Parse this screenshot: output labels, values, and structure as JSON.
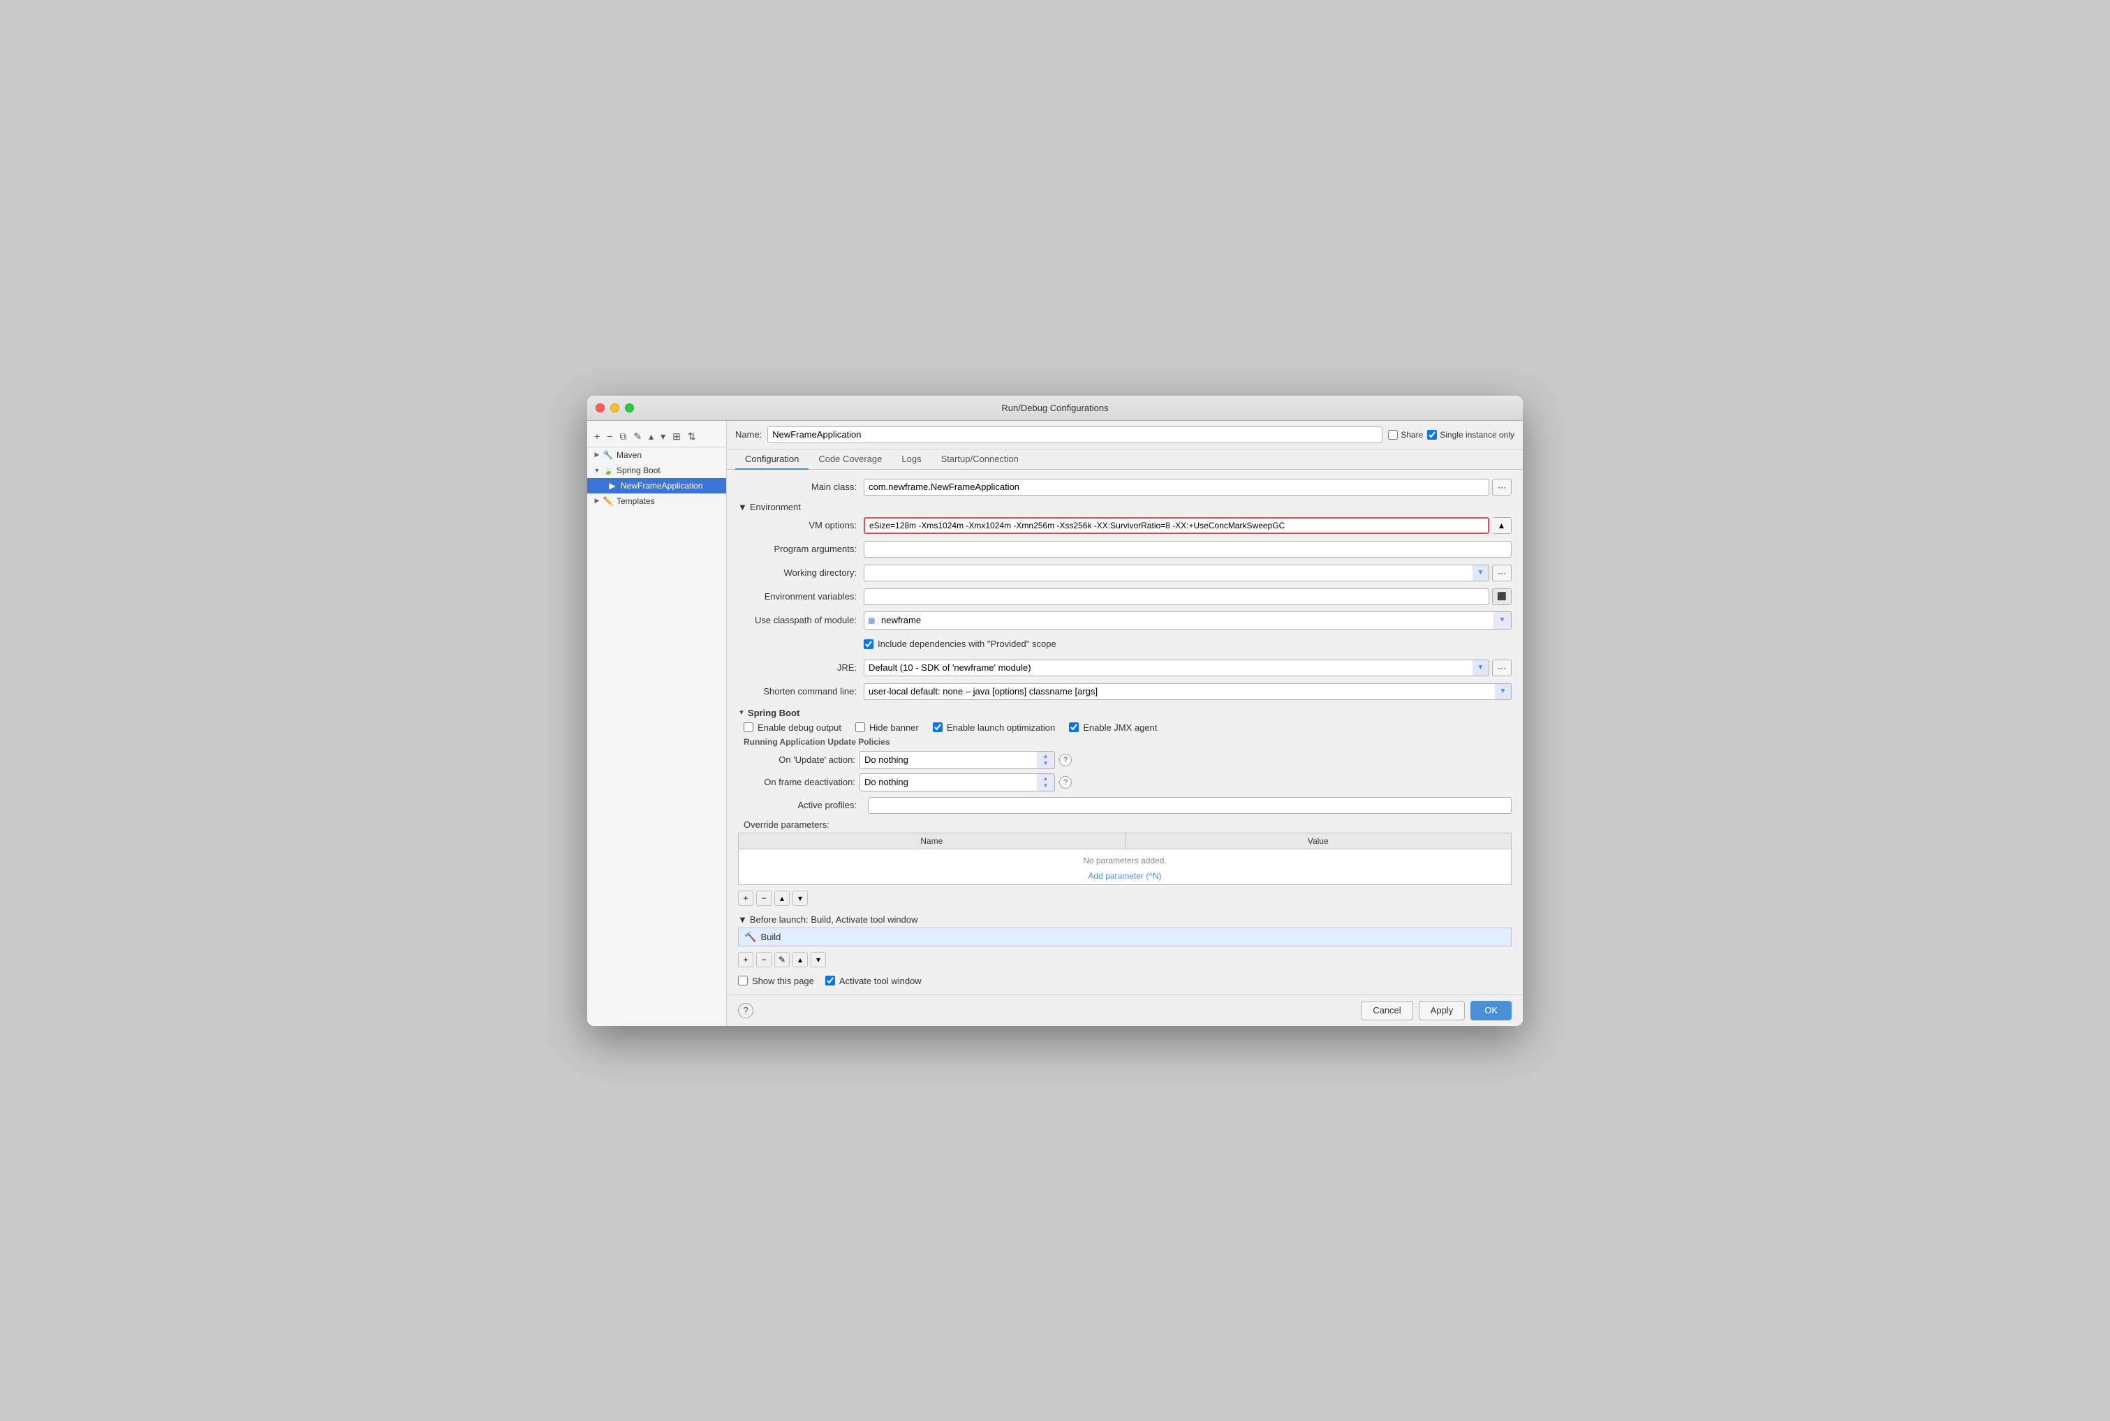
{
  "titlebar": {
    "title": "Run/Debug Configurations"
  },
  "sidebar": {
    "toolbar": {
      "add": "+",
      "remove": "−",
      "copy": "⧉",
      "edit": "✎",
      "up": "▲",
      "down": "▼",
      "group": "⊞",
      "sort": "⇅"
    },
    "items": [
      {
        "id": "maven",
        "label": "Maven",
        "type": "group",
        "expanded": false,
        "indent": 0
      },
      {
        "id": "spring-boot",
        "label": "Spring Boot",
        "type": "group",
        "expanded": true,
        "indent": 0
      },
      {
        "id": "newframe",
        "label": "NewFrameApplication",
        "type": "item",
        "indent": 1,
        "selected": true
      },
      {
        "id": "templates",
        "label": "Templates",
        "type": "group",
        "expanded": false,
        "indent": 0
      }
    ]
  },
  "name_bar": {
    "label": "Name:",
    "value": "NewFrameApplication",
    "share_label": "Share",
    "single_instance_label": "Single instance only",
    "share_checked": false,
    "single_instance_checked": true
  },
  "tabs": {
    "items": [
      "Configuration",
      "Code Coverage",
      "Logs",
      "Startup/Connection"
    ],
    "active": 0
  },
  "config": {
    "main_class_label": "Main class:",
    "main_class_value": "com.newframe.NewFrameApplication",
    "environment_header": "Environment",
    "vm_options_label": "VM options:",
    "vm_options_value": "eSizе=128m -Xms1024m -Xmx1024m -Xmn256m -Xss256k -XX:SurvivorRatio=8 -XX:+UseConcMarkSweepGC",
    "program_args_label": "Program arguments:",
    "program_args_value": "",
    "working_dir_label": "Working directory:",
    "working_dir_value": "",
    "env_vars_label": "Environment variables:",
    "env_vars_value": "",
    "classpath_label": "Use classpath of module:",
    "classpath_value": "newframe",
    "include_deps_label": "Include dependencies with \"Provided\" scope",
    "include_deps_checked": true,
    "jre_label": "JRE:",
    "jre_value": "Default (10 - SDK of 'newframe' module)",
    "shorten_cmd_label": "Shorten command line:",
    "shorten_cmd_value": "user-local default: none – java [options] classname [args]",
    "springboot_header": "Spring Boot",
    "enable_debug_label": "Enable debug output",
    "enable_debug_checked": false,
    "hide_banner_label": "Hide banner",
    "hide_banner_checked": false,
    "enable_launch_label": "Enable launch optimization",
    "enable_launch_checked": true,
    "enable_jmx_label": "Enable JMX agent",
    "enable_jmx_checked": true,
    "running_policies_label": "Running Application Update Policies",
    "on_update_label": "On 'Update' action:",
    "on_update_value": "Do nothing",
    "on_deactivation_label": "On frame deactivation:",
    "on_deactivation_value": "Do nothing",
    "active_profiles_label": "Active profiles:",
    "active_profiles_value": "",
    "override_params_label": "Override parameters:",
    "table_name_col": "Name",
    "table_value_col": "Value",
    "table_empty": "No parameters added.",
    "table_add_link": "Add parameter (^N)",
    "before_launch_header": "Before launch: Build, Activate tool window",
    "build_item": "Build",
    "show_page_label": "Show this page",
    "show_page_checked": false,
    "activate_window_label": "Activate tool window",
    "activate_window_checked": true
  },
  "buttons": {
    "cancel": "Cancel",
    "apply": "Apply",
    "ok": "OK"
  }
}
